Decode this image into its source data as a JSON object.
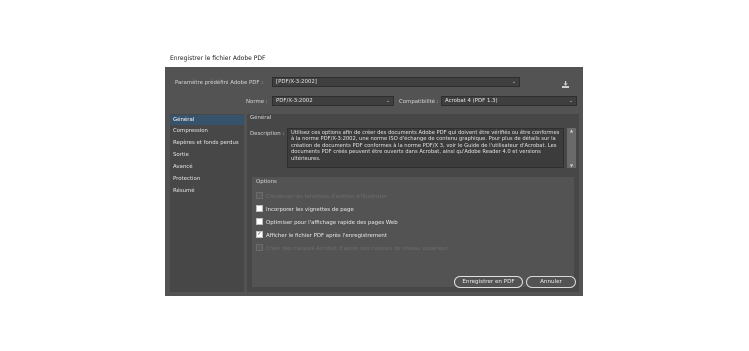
{
  "window": {
    "title": "Enregistrer le fichier Adobe PDF"
  },
  "preset": {
    "label": "Paramètre prédéfini Adobe PDF :",
    "value": "[PDF/X-3:2002]"
  },
  "norme": {
    "label": "Norme :",
    "value": "PDF/X-3:2002"
  },
  "compat": {
    "label": "Compatibilité :",
    "value": "Acrobat 4 (PDF 1.3)"
  },
  "sidebar": {
    "items": [
      {
        "label": "Général"
      },
      {
        "label": "Compression"
      },
      {
        "label": "Repères et fonds perdus"
      },
      {
        "label": "Sortie"
      },
      {
        "label": "Avancé"
      },
      {
        "label": "Protection"
      },
      {
        "label": "Résumé"
      }
    ]
  },
  "panel": {
    "title": "Général",
    "description_label": "Description :",
    "description": "Utilisez ces options afin de créer des documents Adobe PDF qui doivent être vérifiés ou être conformes à la norme PDF/X-3:2002, une norme ISO d'échange de contenu graphique. Pour plus de détails sur la création de documents PDF conformes à la norme PDF/X 3, voir le Guide de l'utilisateur d'Acrobat. Les documents PDF créés peuvent être ouverts dans Acrobat, ainsi qu'Adobe Reader 4.0 et versions ultérieures.",
    "options_title": "Options",
    "options": [
      {
        "label": "Conserver les fonctions d'édition d'Illustrator",
        "checked": "",
        "state": "disabled"
      },
      {
        "label": "Incorporer les vignettes de page",
        "checked": "",
        "state": "enabled"
      },
      {
        "label": "Optimiser pour l'affichage rapide des pages Web",
        "checked": "",
        "state": "enabled"
      },
      {
        "label": "Afficher le fichier PDF après l'enregistrement",
        "checked": "✓",
        "state": "enabled"
      },
      {
        "label": "Créer des calques Acrobat d'après des calques de niveau supérieur",
        "checked": "",
        "state": "disabled"
      }
    ]
  },
  "buttons": {
    "save": "Enregistrer en PDF",
    "cancel": "Annuler"
  },
  "colors": {
    "dialog_bg": "#535353",
    "panel_bg": "#474747",
    "selection": "#37526b"
  }
}
